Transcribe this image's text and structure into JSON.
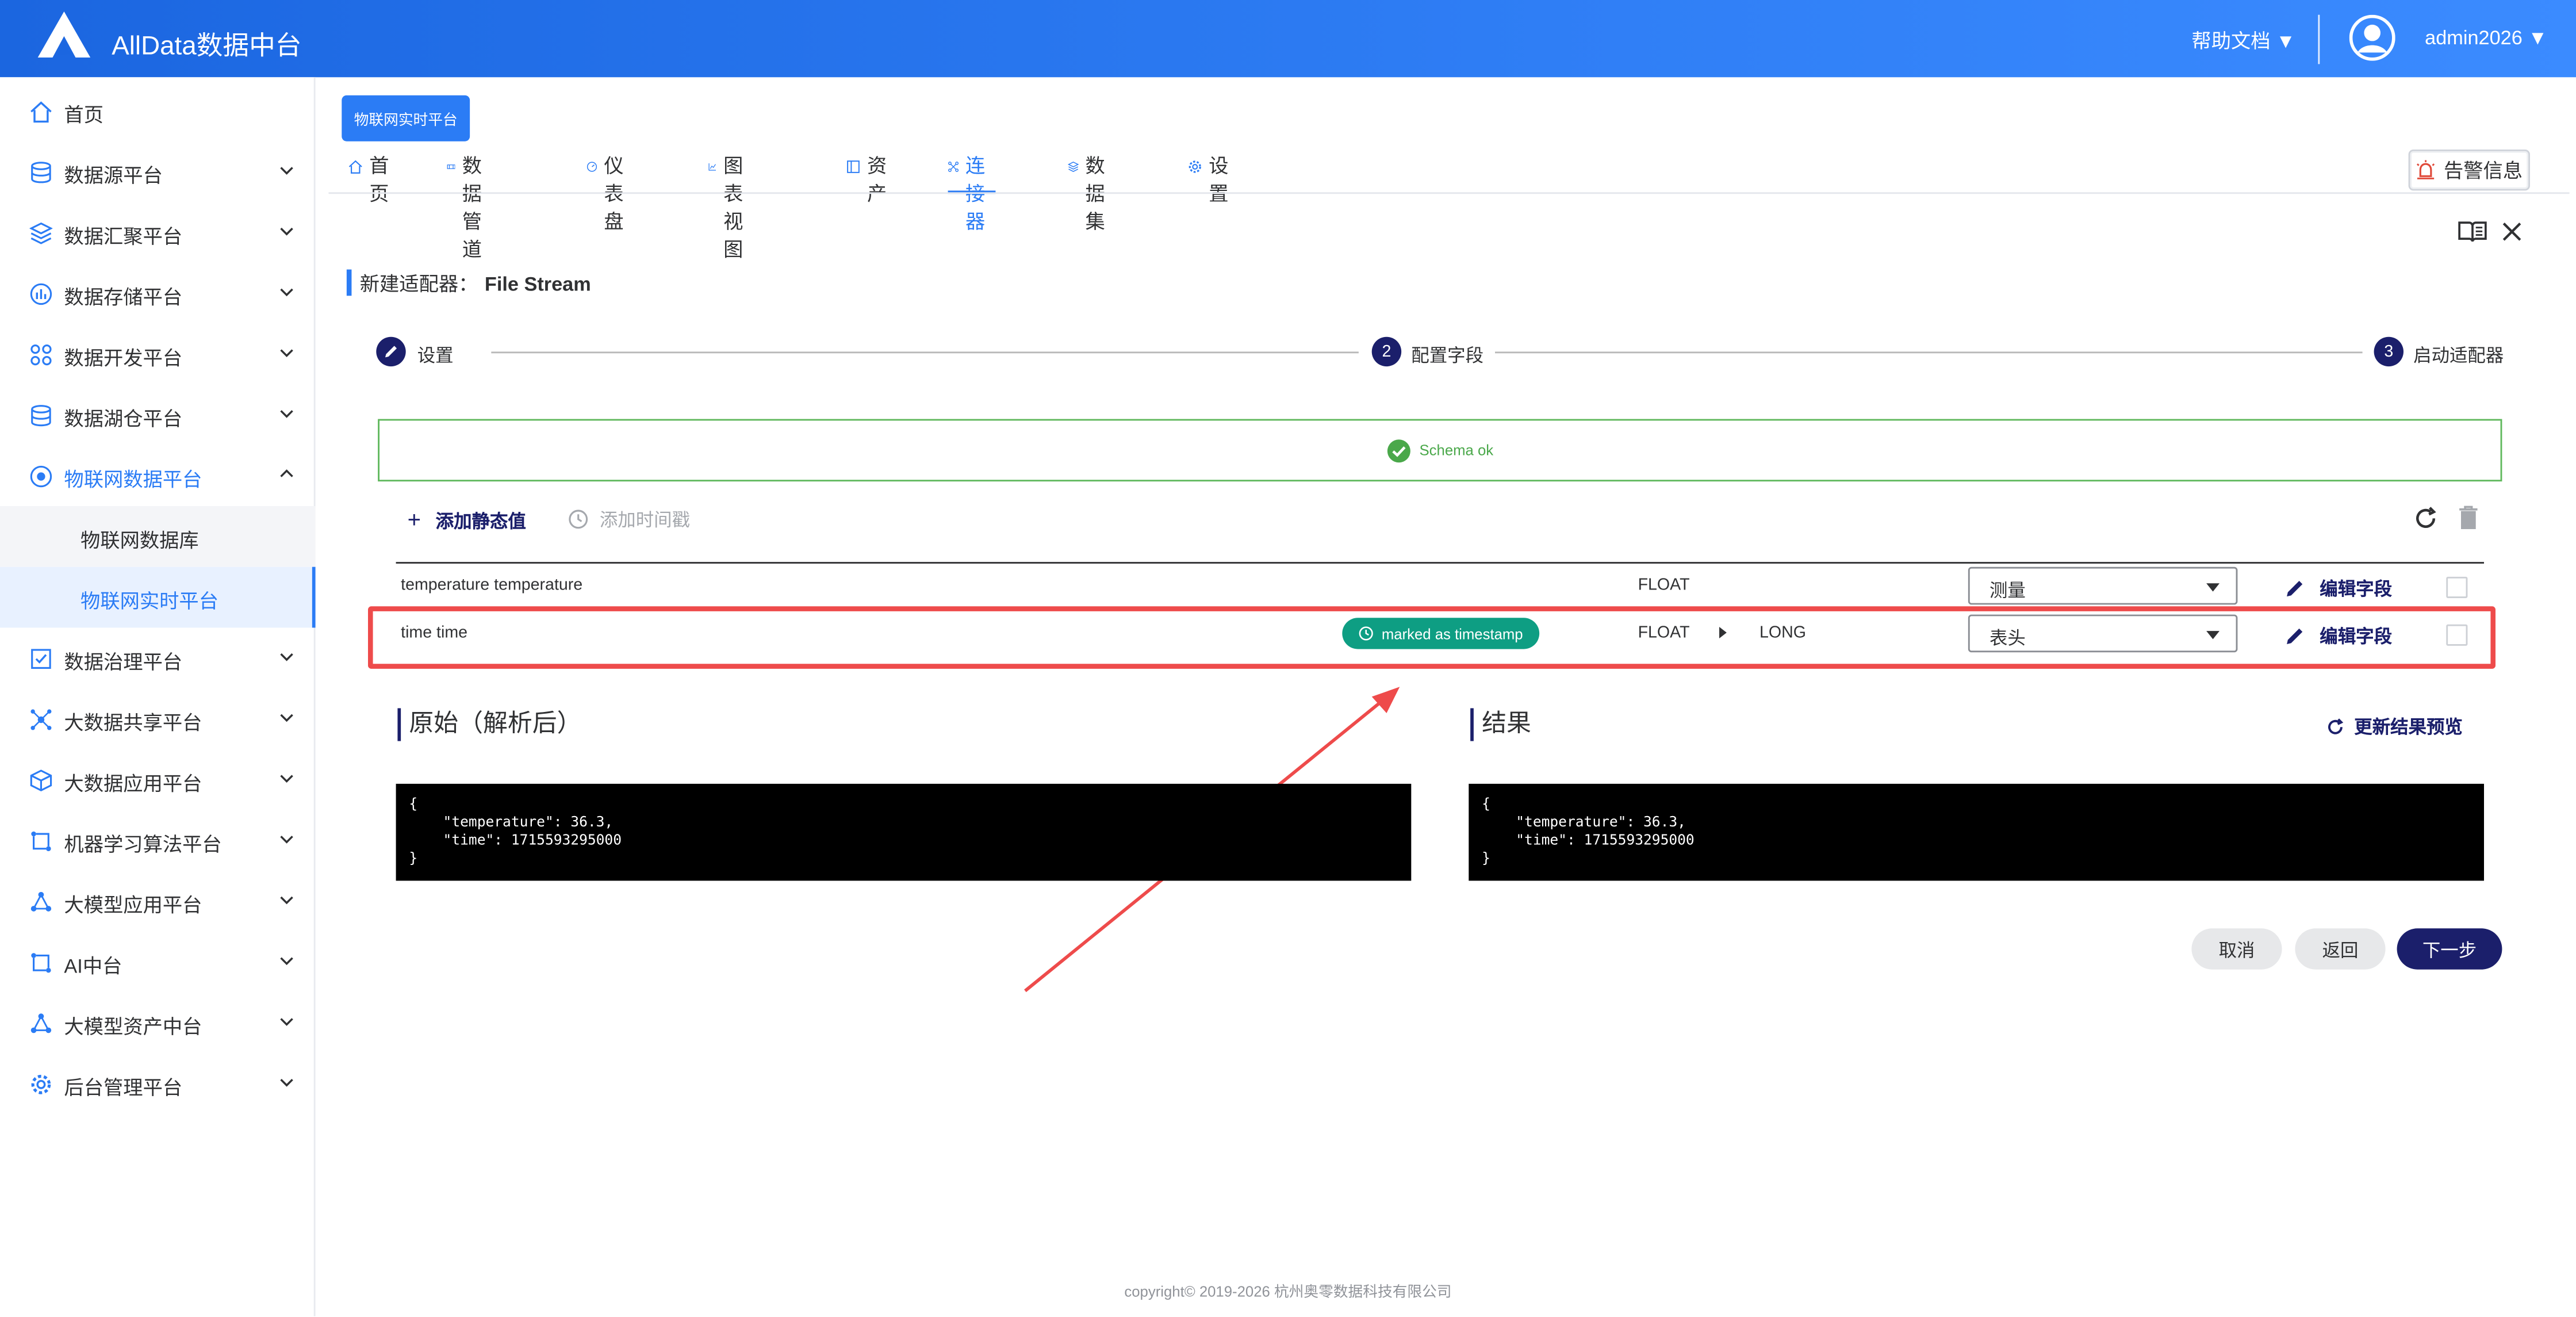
{
  "app": {
    "title": "AllData数据中台"
  },
  "header": {
    "help": "帮助文档 ▼",
    "user": "admin2026 ▼"
  },
  "sidebar": {
    "items": [
      {
        "label": "首页"
      },
      {
        "label": "数据源平台"
      },
      {
        "label": "数据汇聚平台"
      },
      {
        "label": "数据存储平台"
      },
      {
        "label": "数据开发平台"
      },
      {
        "label": "数据湖仓平台"
      },
      {
        "label": "物联网数据平台"
      },
      {
        "label": "数据治理平台"
      },
      {
        "label": "大数据共享平台"
      },
      {
        "label": "大数据应用平台"
      },
      {
        "label": "机器学习算法平台"
      },
      {
        "label": "大模型应用平台"
      },
      {
        "label": "AI中台"
      },
      {
        "label": "大模型资产中台"
      },
      {
        "label": "后台管理平台"
      }
    ],
    "sub": [
      {
        "label": "物联网数据库"
      },
      {
        "label": "物联网实时平台"
      }
    ]
  },
  "main": {
    "platform_button": "物联网实时平台",
    "tabs": [
      {
        "label": "首页"
      },
      {
        "label": "数据管道"
      },
      {
        "label": "仪表盘"
      },
      {
        "label": "图表视图"
      },
      {
        "label": "资产"
      },
      {
        "label": "连接器"
      },
      {
        "label": "数据集"
      },
      {
        "label": "设置"
      }
    ],
    "alarm": "告警信息",
    "page_title_prefix": "新建适配器：",
    "page_title_name": "File Stream",
    "steps": [
      {
        "num": "",
        "label": "设置"
      },
      {
        "num": "2",
        "label": "配置字段"
      },
      {
        "num": "3",
        "label": "启动适配器"
      }
    ],
    "schema_status": "Schema ok",
    "add_static": "添加静态值",
    "add_timestamp": "添加时间戳",
    "fields": [
      {
        "name": "temperature temperature",
        "type": "FLOAT",
        "new_type": "",
        "badge": "",
        "role": "测量",
        "edit": "编辑字段"
      },
      {
        "name": "time time",
        "type": "FLOAT",
        "new_type": "LONG",
        "badge": "marked as timestamp",
        "role": "表头",
        "edit": "编辑字段"
      }
    ],
    "original_title": "原始（解析后）",
    "result_title": "结果",
    "update_preview": "更新结果预览",
    "original_json": "{\n    \"temperature\": 36.3,\n    \"time\": 1715593295000\n}",
    "result_json": "{\n    \"temperature\": 36.3,\n    \"time\": 1715593295000\n}",
    "buttons": {
      "cancel": "取消",
      "back": "返回",
      "next": "下一步"
    }
  },
  "footer": {
    "text": "copyright© 2019-2026 杭州奥零数据科技有限公司"
  },
  "colors": {
    "primary": "#2b7cf5",
    "dark": "#1b1f6b",
    "success": "#5fb85c",
    "badge": "#0e9e83",
    "highlight": "#ee4b4b"
  }
}
